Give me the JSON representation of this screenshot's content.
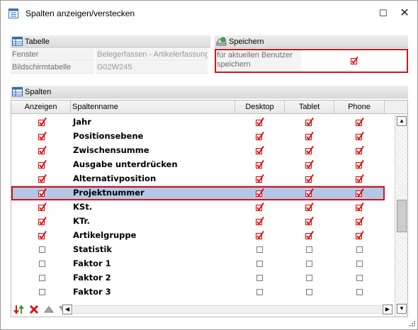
{
  "window": {
    "title": "Spalten anzeigen/verstecken",
    "maximize_glyph": "☐",
    "close_glyph": "✕"
  },
  "table_section": {
    "header": "Tabelle",
    "rows": [
      {
        "key": "Fenster",
        "value": "Belegerfassen - Artikelerfassung"
      },
      {
        "key": "Bildschirmtabelle",
        "value": "G02W245"
      }
    ]
  },
  "save_section": {
    "header": "Speichern",
    "label": "für aktuellen Benutzer speichern",
    "checked": true
  },
  "columns_section": {
    "header": "Spalten",
    "col_headers": [
      "Anzeigen",
      "Spaltenname",
      "Desktop",
      "Tablet",
      "Phone"
    ],
    "rows": [
      {
        "name": "Jahr",
        "show": true,
        "desktop": true,
        "tablet": true,
        "phone": true,
        "selected": false
      },
      {
        "name": "Positionsebene",
        "show": true,
        "desktop": true,
        "tablet": true,
        "phone": true,
        "selected": false
      },
      {
        "name": "Zwischensumme",
        "show": true,
        "desktop": true,
        "tablet": true,
        "phone": true,
        "selected": false
      },
      {
        "name": "Ausgabe unterdrücken",
        "show": true,
        "desktop": true,
        "tablet": true,
        "phone": true,
        "selected": false
      },
      {
        "name": "Alternativposition",
        "show": true,
        "desktop": true,
        "tablet": true,
        "phone": true,
        "selected": false
      },
      {
        "name": "Projektnummer",
        "show": true,
        "desktop": true,
        "tablet": true,
        "phone": true,
        "selected": true
      },
      {
        "name": "KSt.",
        "show": true,
        "desktop": true,
        "tablet": true,
        "phone": true,
        "selected": false
      },
      {
        "name": "KTr.",
        "show": true,
        "desktop": true,
        "tablet": true,
        "phone": true,
        "selected": false
      },
      {
        "name": "Artikelgruppe",
        "show": true,
        "desktop": true,
        "tablet": true,
        "phone": true,
        "selected": false
      },
      {
        "name": "Statistik",
        "show": false,
        "desktop": false,
        "tablet": false,
        "phone": false,
        "selected": false
      },
      {
        "name": "Faktor 1",
        "show": false,
        "desktop": false,
        "tablet": false,
        "phone": false,
        "selected": false
      },
      {
        "name": "Faktor 2",
        "show": false,
        "desktop": false,
        "tablet": false,
        "phone": false,
        "selected": false
      },
      {
        "name": "Faktor 3",
        "show": false,
        "desktop": false,
        "tablet": false,
        "phone": false,
        "selected": false
      }
    ]
  },
  "footer_tools": [
    "sort-order-icon",
    "delete-icon",
    "move-up-icon",
    "move-down-icon"
  ],
  "colors": {
    "highlight_red": "#d0161c",
    "selected_row": "#b3c8e6",
    "check_red": "#e00000"
  }
}
